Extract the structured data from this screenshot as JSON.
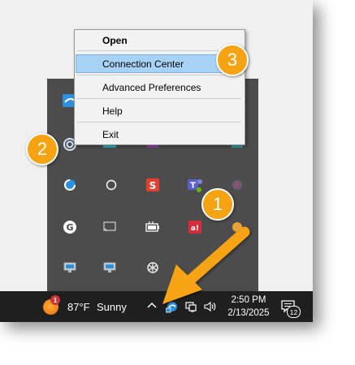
{
  "context_menu": {
    "items": [
      {
        "label": "Open",
        "bold": true
      },
      {
        "label": "Connection Center",
        "highlighted": true
      },
      {
        "label": "Advanced Preferences"
      },
      {
        "label": "Help"
      },
      {
        "label": "Exit"
      }
    ]
  },
  "taskbar": {
    "weather": {
      "temperature": "87°F",
      "condition": "Sunny",
      "badge": "1"
    },
    "clock": {
      "time": "2:50 PM",
      "date": "2/13/2025"
    },
    "notification_count": "12"
  },
  "callouts": [
    "1",
    "2",
    "3"
  ],
  "colors": {
    "accent_orange": "#f6a313",
    "menu_highlight": "#a8d2f5",
    "tray_background": "#4c4c4c",
    "taskbar_background": "#1f1f1f",
    "workspace_icon_blue": "#2b8fe0"
  },
  "tray_icons": [
    "citrix-workspace-icon",
    "citrix-alt-icon",
    "purple-square-icon",
    "circle-app-icon",
    "teal-app-icon",
    "workspace-spiral-icon",
    "circle-outline-icon",
    "red-s-app-icon",
    "teams-icon",
    "generic-app-icon",
    "grammarly-icon",
    "cast-screen-icon",
    "battery-icon",
    "red-app-icon",
    "app-icon",
    "monitor-icon",
    "monitor-icon",
    "openai-icon"
  ]
}
